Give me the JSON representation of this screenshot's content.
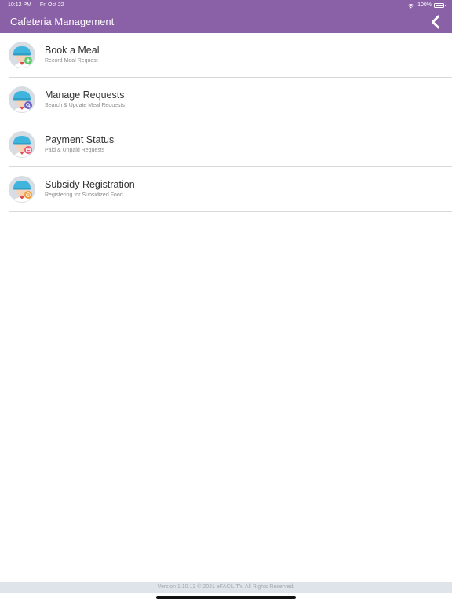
{
  "status_bar": {
    "time": "10:12 PM",
    "date": "Fri Oct 22",
    "battery": "100%",
    "wifi_icon": "wifi-icon",
    "battery_icon": "battery-full-icon"
  },
  "header": {
    "title": "Cafeteria Management",
    "back_icon": "chevron-left-icon"
  },
  "menu": {
    "items": [
      {
        "title": "Book a Meal",
        "subtitle": "Record Meal Request",
        "icon": "chef-add-icon",
        "badge_color": "#5ec86b"
      },
      {
        "title": "Manage Requests",
        "subtitle": "Search & Update Meal Requests",
        "icon": "chef-search-icon",
        "badge_color": "#6a64c8"
      },
      {
        "title": "Payment Status",
        "subtitle": "Paid & Unpaid Requests",
        "icon": "chef-payment-icon",
        "badge_color": "#ef5a74"
      },
      {
        "title": "Subsidy Registration",
        "subtitle": "Registering for Subsidized Food",
        "icon": "chef-subsidy-icon",
        "badge_color": "#f39a2c"
      }
    ]
  },
  "footer": {
    "text": "Version 1.10.13 © 2021 eFACiLiTY. All Rights Reserved."
  },
  "colors": {
    "header_bg": "#8a60a6",
    "avatar_bg": "#d8dde3",
    "hat": "#3fb4dc",
    "face": "#f6d2b8",
    "footer_bg": "#dfe4ea"
  }
}
